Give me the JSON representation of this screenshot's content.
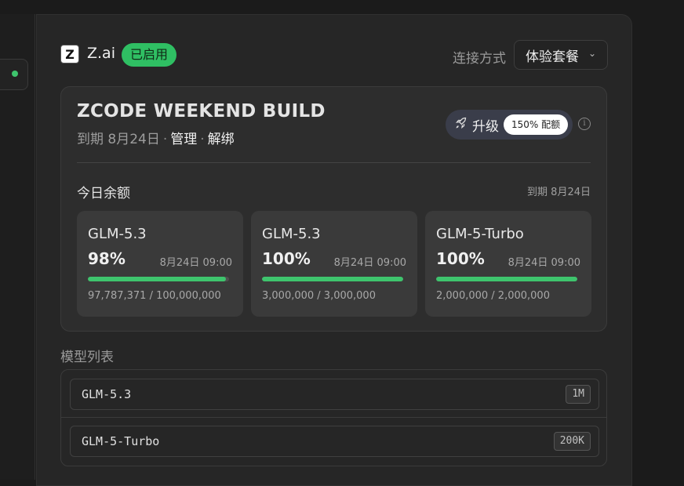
{
  "sidebar": {
    "status_color": "#3ec46d"
  },
  "header": {
    "logo_letter": "Z",
    "brand": "Z.ai",
    "status_badge": "已启用",
    "connection_label": "连接方式",
    "plan_select": "体验套餐"
  },
  "plan": {
    "title": "ZCODE WEEKEND BUILD",
    "expiry": "到期 8月24日",
    "manage_link": "管理",
    "unbind_link": "解绑",
    "upgrade_label": "升级",
    "upgrade_pill": "150% 配额"
  },
  "quota": {
    "label": "今日余额",
    "expiry": "到期 8月24日",
    "items": [
      {
        "name": "GLM-5.3",
        "percent": "98%",
        "fill": 98,
        "time": "8月24日 09:00",
        "usage": "97,787,371 / 100,000,000"
      },
      {
        "name": "GLM-5.3",
        "percent": "100%",
        "fill": 100,
        "time": "8月24日 09:00",
        "usage": "3,000,000 / 3,000,000"
      },
      {
        "name": "GLM-5-Turbo",
        "percent": "100%",
        "fill": 100,
        "time": "8月24日 09:00",
        "usage": "2,000,000 / 2,000,000"
      }
    ]
  },
  "models": {
    "label": "模型列表",
    "items": [
      {
        "name": "GLM-5.3",
        "context": "1M"
      },
      {
        "name": "GLM-5-Turbo",
        "context": "200K"
      }
    ]
  },
  "colors": {
    "accent_green": "#3ec46d",
    "badge_green": "#2fbf63"
  }
}
